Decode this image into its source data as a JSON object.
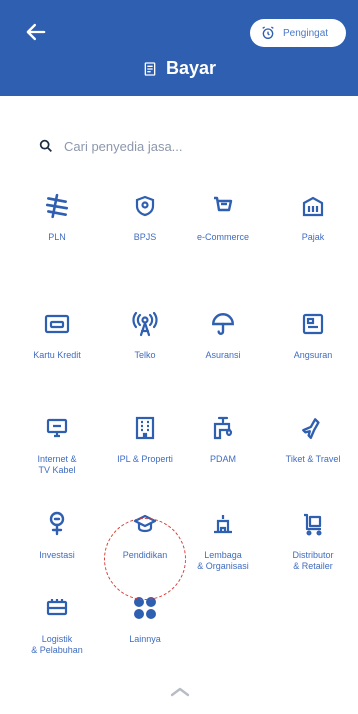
{
  "header": {
    "title": "Bayar",
    "reminder_label": "Pengingat"
  },
  "search": {
    "placeholder": "Cari penyedia jasa..."
  },
  "categories": [
    {
      "label": "PLN",
      "icon": "lightning-icon"
    },
    {
      "label": "BPJS",
      "icon": "shield-icon"
    },
    {
      "label": "e-Commerce",
      "icon": "cart-icon"
    },
    {
      "label": "Pajak",
      "icon": "building-icon"
    },
    {
      "label": "Kartu Kredit",
      "icon": "credit-card-icon"
    },
    {
      "label": "Telko",
      "icon": "antenna-icon"
    },
    {
      "label": "Asuransi",
      "icon": "umbrella-icon"
    },
    {
      "label": "Angsuran",
      "icon": "installment-icon"
    },
    {
      "label": "Internet &\nTV Kabel",
      "icon": "monitor-icon"
    },
    {
      "label": "IPL & Properti",
      "icon": "apartment-icon"
    },
    {
      "label": "PDAM",
      "icon": "water-tap-icon"
    },
    {
      "label": "Tiket & Travel",
      "icon": "airplane-icon"
    },
    {
      "label": "Investasi",
      "icon": "investment-icon"
    },
    {
      "label": "Pendidikan",
      "icon": "graduation-cap-icon"
    },
    {
      "label": "Lembaga\n& Organisasi",
      "icon": "institution-icon"
    },
    {
      "label": "Distributor\n& Retailer",
      "icon": "cart-box-icon"
    },
    {
      "label": "Logistik\n& Pelabuhan",
      "icon": "truck-icon"
    },
    {
      "label": "Lainnya",
      "icon": "more-grid-icon"
    }
  ],
  "colors": {
    "header": "#2f5fb0",
    "icon": "#2f5fb0",
    "label": "#3f6cc0",
    "highlight": "#d9403a"
  }
}
